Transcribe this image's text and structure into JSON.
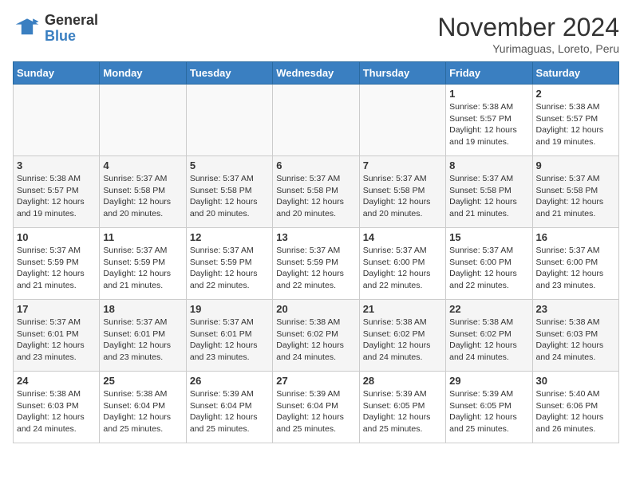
{
  "header": {
    "logo_general": "General",
    "logo_blue": "Blue",
    "month_title": "November 2024",
    "location": "Yurimaguas, Loreto, Peru"
  },
  "days_of_week": [
    "Sunday",
    "Monday",
    "Tuesday",
    "Wednesday",
    "Thursday",
    "Friday",
    "Saturday"
  ],
  "weeks": [
    [
      {
        "day": "",
        "info": ""
      },
      {
        "day": "",
        "info": ""
      },
      {
        "day": "",
        "info": ""
      },
      {
        "day": "",
        "info": ""
      },
      {
        "day": "",
        "info": ""
      },
      {
        "day": "1",
        "info": "Sunrise: 5:38 AM\nSunset: 5:57 PM\nDaylight: 12 hours and 19 minutes."
      },
      {
        "day": "2",
        "info": "Sunrise: 5:38 AM\nSunset: 5:57 PM\nDaylight: 12 hours and 19 minutes."
      }
    ],
    [
      {
        "day": "3",
        "info": "Sunrise: 5:38 AM\nSunset: 5:57 PM\nDaylight: 12 hours and 19 minutes."
      },
      {
        "day": "4",
        "info": "Sunrise: 5:37 AM\nSunset: 5:58 PM\nDaylight: 12 hours and 20 minutes."
      },
      {
        "day": "5",
        "info": "Sunrise: 5:37 AM\nSunset: 5:58 PM\nDaylight: 12 hours and 20 minutes."
      },
      {
        "day": "6",
        "info": "Sunrise: 5:37 AM\nSunset: 5:58 PM\nDaylight: 12 hours and 20 minutes."
      },
      {
        "day": "7",
        "info": "Sunrise: 5:37 AM\nSunset: 5:58 PM\nDaylight: 12 hours and 20 minutes."
      },
      {
        "day": "8",
        "info": "Sunrise: 5:37 AM\nSunset: 5:58 PM\nDaylight: 12 hours and 21 minutes."
      },
      {
        "day": "9",
        "info": "Sunrise: 5:37 AM\nSunset: 5:58 PM\nDaylight: 12 hours and 21 minutes."
      }
    ],
    [
      {
        "day": "10",
        "info": "Sunrise: 5:37 AM\nSunset: 5:59 PM\nDaylight: 12 hours and 21 minutes."
      },
      {
        "day": "11",
        "info": "Sunrise: 5:37 AM\nSunset: 5:59 PM\nDaylight: 12 hours and 21 minutes."
      },
      {
        "day": "12",
        "info": "Sunrise: 5:37 AM\nSunset: 5:59 PM\nDaylight: 12 hours and 22 minutes."
      },
      {
        "day": "13",
        "info": "Sunrise: 5:37 AM\nSunset: 5:59 PM\nDaylight: 12 hours and 22 minutes."
      },
      {
        "day": "14",
        "info": "Sunrise: 5:37 AM\nSunset: 6:00 PM\nDaylight: 12 hours and 22 minutes."
      },
      {
        "day": "15",
        "info": "Sunrise: 5:37 AM\nSunset: 6:00 PM\nDaylight: 12 hours and 22 minutes."
      },
      {
        "day": "16",
        "info": "Sunrise: 5:37 AM\nSunset: 6:00 PM\nDaylight: 12 hours and 23 minutes."
      }
    ],
    [
      {
        "day": "17",
        "info": "Sunrise: 5:37 AM\nSunset: 6:01 PM\nDaylight: 12 hours and 23 minutes."
      },
      {
        "day": "18",
        "info": "Sunrise: 5:37 AM\nSunset: 6:01 PM\nDaylight: 12 hours and 23 minutes."
      },
      {
        "day": "19",
        "info": "Sunrise: 5:37 AM\nSunset: 6:01 PM\nDaylight: 12 hours and 23 minutes."
      },
      {
        "day": "20",
        "info": "Sunrise: 5:38 AM\nSunset: 6:02 PM\nDaylight: 12 hours and 24 minutes."
      },
      {
        "day": "21",
        "info": "Sunrise: 5:38 AM\nSunset: 6:02 PM\nDaylight: 12 hours and 24 minutes."
      },
      {
        "day": "22",
        "info": "Sunrise: 5:38 AM\nSunset: 6:02 PM\nDaylight: 12 hours and 24 minutes."
      },
      {
        "day": "23",
        "info": "Sunrise: 5:38 AM\nSunset: 6:03 PM\nDaylight: 12 hours and 24 minutes."
      }
    ],
    [
      {
        "day": "24",
        "info": "Sunrise: 5:38 AM\nSunset: 6:03 PM\nDaylight: 12 hours and 24 minutes."
      },
      {
        "day": "25",
        "info": "Sunrise: 5:38 AM\nSunset: 6:04 PM\nDaylight: 12 hours and 25 minutes."
      },
      {
        "day": "26",
        "info": "Sunrise: 5:39 AM\nSunset: 6:04 PM\nDaylight: 12 hours and 25 minutes."
      },
      {
        "day": "27",
        "info": "Sunrise: 5:39 AM\nSunset: 6:04 PM\nDaylight: 12 hours and 25 minutes."
      },
      {
        "day": "28",
        "info": "Sunrise: 5:39 AM\nSunset: 6:05 PM\nDaylight: 12 hours and 25 minutes."
      },
      {
        "day": "29",
        "info": "Sunrise: 5:39 AM\nSunset: 6:05 PM\nDaylight: 12 hours and 25 minutes."
      },
      {
        "day": "30",
        "info": "Sunrise: 5:40 AM\nSunset: 6:06 PM\nDaylight: 12 hours and 26 minutes."
      }
    ]
  ]
}
